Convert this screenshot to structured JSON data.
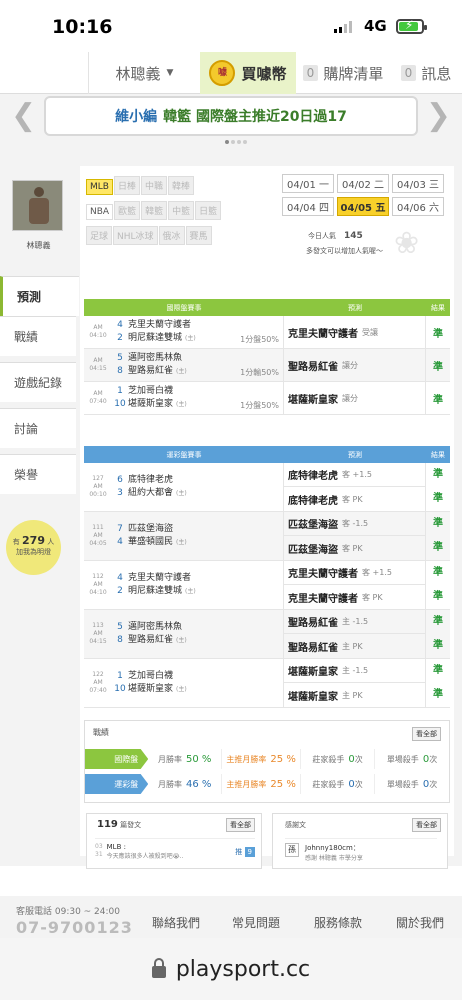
{
  "status": {
    "time": "10:16",
    "network": "4G"
  },
  "nav": {
    "user": "林聰義",
    "coin": "買噱幣",
    "coin_icon": "噱",
    "buy_count": "0",
    "buy_label": "購牌清單",
    "msg_count": "0",
    "msg_label": "訊息"
  },
  "banner": {
    "prefix": "維小編",
    "text": "韓籃 國際盤主推近20日過17"
  },
  "profile": {
    "name": "林聰義"
  },
  "menu": [
    "預測",
    "戰績",
    "遊戲紀錄",
    "討論",
    "榮譽"
  ],
  "fans": {
    "prefix": "有",
    "count": "279",
    "unit": "人",
    "line2": "加我為明燈"
  },
  "sports": [
    "MLB",
    "日棒",
    "中職",
    "韓棒",
    "NBA",
    "歐籃",
    "韓籃",
    "中籃",
    "日籃",
    "足球",
    "NHL冰球",
    "俄冰",
    "賽馬"
  ],
  "dates": [
    "04/01 一",
    "04/02 二",
    "04/03 三",
    "04/04 四",
    "04/05 五",
    "04/06 六"
  ],
  "popularity": {
    "label": "今日人氣",
    "value": "145",
    "note": "多發文可以增加人氣喔～"
  },
  "intl": {
    "headers": [
      "國際盤賽事",
      "預測",
      "結果"
    ],
    "rows": [
      {
        "time": "AM 04:10",
        "n1": "4",
        "t1": "克里夫蘭守護者",
        "n2": "2",
        "t2": "明尼蘇達雙城",
        "home": "(主)",
        "line": "1分盤50%",
        "pick": "克里夫蘭守護者",
        "note": "受讓",
        "result": "準"
      },
      {
        "time": "AM 04:15",
        "n1": "5",
        "t1": "邁阿密馬林魚",
        "n2": "8",
        "t2": "聖路易紅雀",
        "home": "(主)",
        "line": "1分輸50%",
        "pick": "聖路易紅雀",
        "note": "讓分",
        "result": "準"
      },
      {
        "time": "AM 07:40",
        "n1": "1",
        "t1": "芝加哥白襪",
        "n2": "10",
        "t2": "堪薩斯皇家",
        "home": "(主)",
        "line": "1分盤50%",
        "pick": "堪薩斯皇家",
        "note": "讓分",
        "result": "準"
      }
    ]
  },
  "lottery": {
    "headers": [
      "運彩盤賽事",
      "預測",
      "結果"
    ],
    "rows": [
      {
        "id": "127",
        "time": "AM 00:10",
        "n1": "6",
        "t1": "底特律老虎",
        "n2": "3",
        "t2": "紐約大都會",
        "home": "(主)",
        "picks": [
          {
            "team": "底特律老虎",
            "note": "客 +1.5",
            "result": "準"
          },
          {
            "team": "底特律老虎",
            "note": "客 PK",
            "result": "準"
          }
        ]
      },
      {
        "id": "111",
        "time": "AM 04:05",
        "n1": "7",
        "t1": "匹茲堡海盜",
        "n2": "4",
        "t2": "華盛頓國民",
        "home": "(主)",
        "picks": [
          {
            "team": "匹茲堡海盜",
            "note": "客 -1.5",
            "result": "準"
          },
          {
            "team": "匹茲堡海盜",
            "note": "客 PK",
            "result": "準"
          }
        ]
      },
      {
        "id": "112",
        "time": "AM 04:10",
        "n1": "4",
        "t1": "克里夫蘭守護者",
        "n2": "2",
        "t2": "明尼蘇達雙城",
        "home": "(主)",
        "picks": [
          {
            "team": "克里夫蘭守護者",
            "note": "客 +1.5",
            "result": "準"
          },
          {
            "team": "克里夫蘭守護者",
            "note": "客 PK",
            "result": "準"
          }
        ]
      },
      {
        "id": "113",
        "time": "AM 04:15",
        "n1": "5",
        "t1": "邁阿密馬林魚",
        "n2": "8",
        "t2": "聖路易紅雀",
        "home": "(主)",
        "picks": [
          {
            "team": "聖路易紅雀",
            "note": "主 -1.5",
            "result": "準"
          },
          {
            "team": "聖路易紅雀",
            "note": "主 PK",
            "result": "準"
          }
        ]
      },
      {
        "id": "122",
        "time": "AM 07:40",
        "n1": "1",
        "t1": "芝加哥白襪",
        "n2": "10",
        "t2": "堪薩斯皇家",
        "home": "(主)",
        "picks": [
          {
            "team": "堪薩斯皇家",
            "note": "主 -1.5",
            "result": "準"
          },
          {
            "team": "堪薩斯皇家",
            "note": "主 PK",
            "result": "準"
          }
        ]
      }
    ]
  },
  "record": {
    "title": "戰績",
    "more": "看全部",
    "intl": {
      "label": "國際盤",
      "c1": "月勝率",
      "v1": "50 %",
      "c2": "主推月勝率",
      "v2": "25 %",
      "c3": "莊家殺手",
      "v3": "0",
      "u3": "次",
      "c4": "單場殺手",
      "v4": "0",
      "u4": "次"
    },
    "lottery": {
      "label": "運彩盤",
      "c1": "月勝率",
      "v1": "46 %",
      "c2": "主推月勝率",
      "v2": "25 %",
      "c3": "莊家殺手",
      "v3": "0",
      "u3": "次",
      "c4": "單場殺手",
      "v4": "0",
      "u4": "次"
    }
  },
  "posts": {
    "count": "119",
    "label": "篇發文",
    "more": "看全部",
    "date_mo": "03",
    "date_d": "31",
    "cat": "MLB :",
    "text": "今天應該很多人被殺到吧😭..",
    "tag": "推",
    "tag_num": "9"
  },
  "fanpost": {
    "label": "感謝文",
    "more": "看全部",
    "icon": "孫",
    "user": "Johnny180cm：",
    "text": "感謝 林聰義 市學分享"
  },
  "colors": {
    "green": "#8cc63f",
    "blue": "#5aa0d8",
    "gold": "#f8d02a"
  },
  "footer": {
    "service": "客服電話 09:30 ~ 24:00",
    "phone": "07-9700123",
    "links": [
      "聯絡我們",
      "常見問題",
      "服務條款",
      "關於我們"
    ],
    "url": "playsport.cc"
  }
}
